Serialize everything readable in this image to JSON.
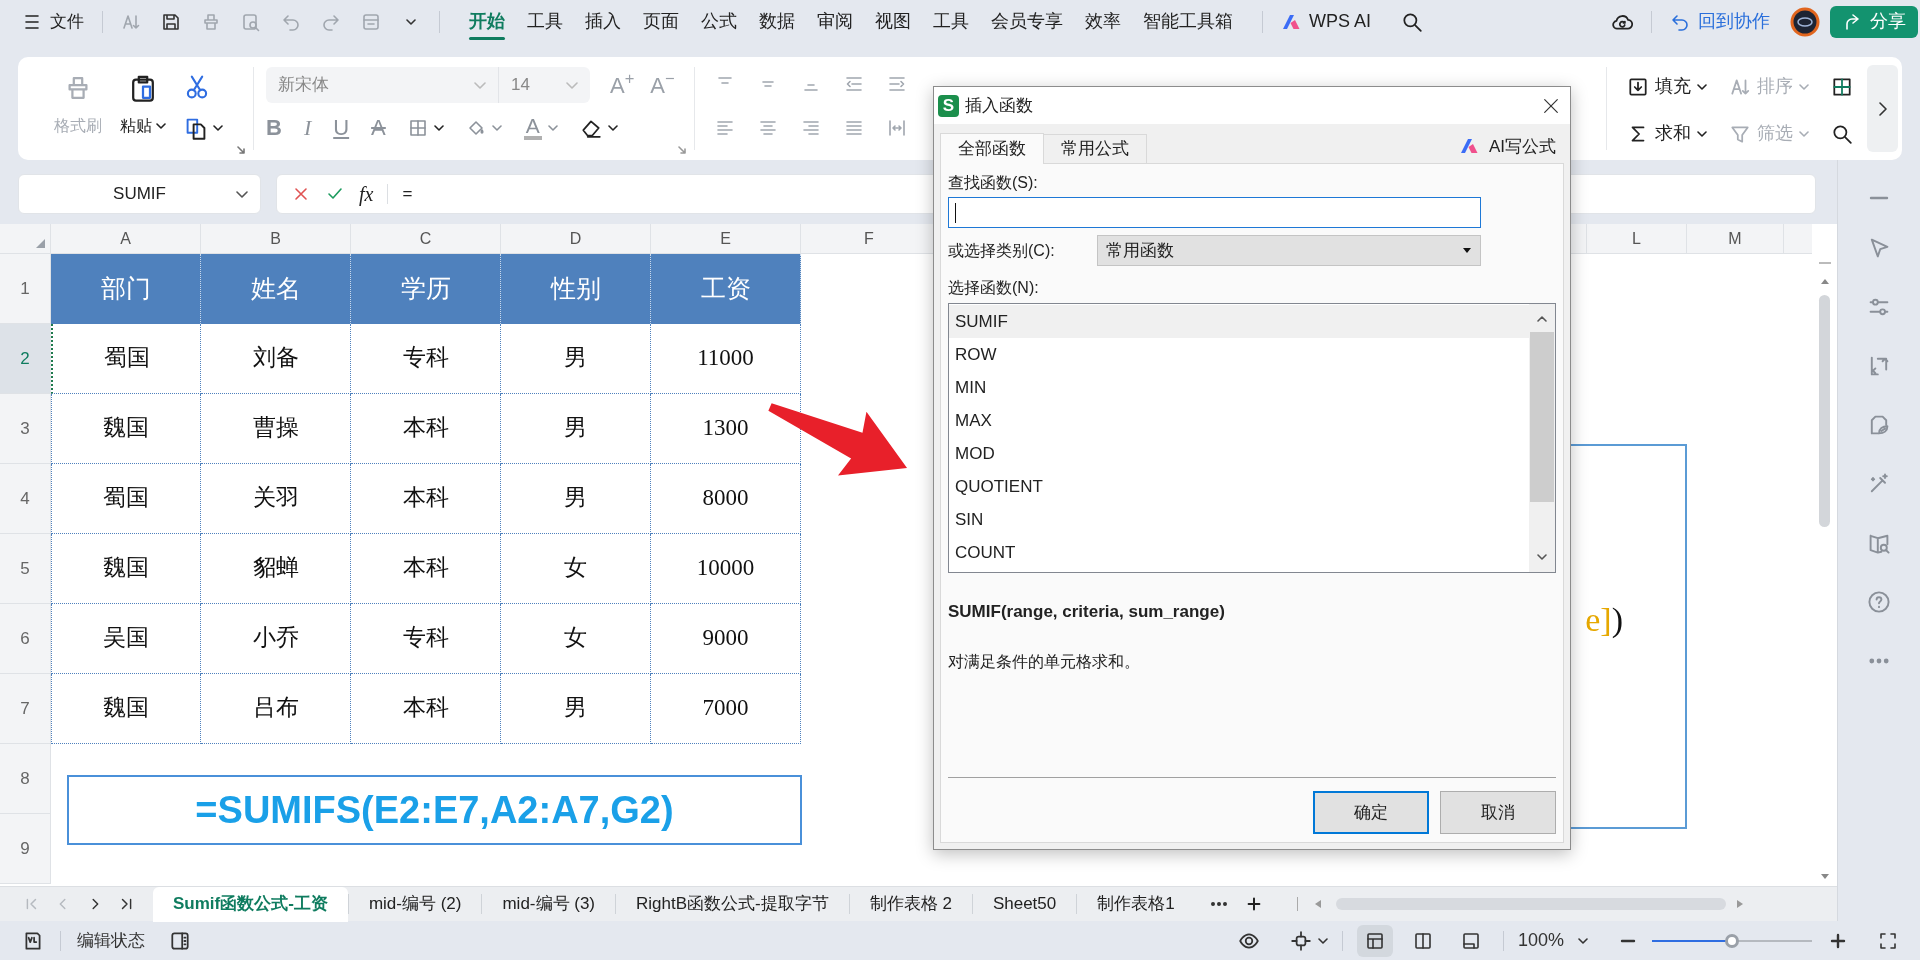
{
  "menu_bar": {
    "file": "文件",
    "tabs": [
      {
        "label": "开始",
        "selected": true
      },
      {
        "label": "工具",
        "selected": false
      },
      {
        "label": "插入",
        "selected": false
      },
      {
        "label": "页面",
        "selected": false
      },
      {
        "label": "公式",
        "selected": false
      },
      {
        "label": "数据",
        "selected": false
      },
      {
        "label": "审阅",
        "selected": false
      },
      {
        "label": "视图",
        "selected": false
      },
      {
        "label": "工具",
        "selected": false
      },
      {
        "label": "会员专享",
        "selected": false
      },
      {
        "label": "效率",
        "selected": false
      },
      {
        "label": "智能工具箱",
        "selected": false
      }
    ],
    "ai": "WPS AI",
    "collab": "回到协作",
    "share": "分享"
  },
  "ribbon": {
    "format_painter": {
      "label": "格式刷",
      "disabled": true
    },
    "paste": {
      "label": "粘贴",
      "disabled": false
    },
    "font_name": "新宋体",
    "font_size": "14",
    "grow_font": "A$^{+}$",
    "shrink_font": "A$^{−}$",
    "font_buttons": [
      {
        "kind": "bold",
        "label": "B"
      },
      {
        "kind": "italic",
        "label": "I"
      },
      {
        "kind": "underline",
        "label": "U"
      },
      {
        "kind": "strike",
        "label": "A"
      }
    ],
    "font_color": "A",
    "tools": [
      {
        "kind": "fill",
        "label": "填充",
        "disabled": false
      },
      {
        "kind": "sum",
        "label": "求和",
        "disabled": false
      },
      {
        "kind": "sort",
        "label": "排序",
        "disabled": true
      },
      {
        "kind": "filter",
        "label": "筛选",
        "disabled": true
      }
    ]
  },
  "formula_bar": {
    "name_box": "SUMIF",
    "fx": "fx",
    "formula": "="
  },
  "sheet": {
    "columns": [
      "A",
      "B",
      "C",
      "D",
      "E",
      "F",
      "L",
      "M"
    ],
    "rows": [
      {
        "label": "1",
        "selected": false
      },
      {
        "label": "2",
        "selected": true
      },
      {
        "label": "3",
        "selected": false
      },
      {
        "label": "4",
        "selected": false
      },
      {
        "label": "5",
        "selected": false
      },
      {
        "label": "6",
        "selected": false
      },
      {
        "label": "7",
        "selected": false
      },
      {
        "label": "8",
        "selected": false
      },
      {
        "label": "9",
        "selected": false
      }
    ],
    "table": {
      "header": [
        "部门",
        "姓名",
        "学历",
        "性别",
        "工资"
      ],
      "rows": [
        [
          "蜀国",
          "刘备",
          "专科",
          "男",
          "11000"
        ],
        [
          "魏国",
          "曹操",
          "本科",
          "男",
          "1300"
        ],
        [
          "蜀国",
          "关羽",
          "本科",
          "男",
          "8000"
        ],
        [
          "魏国",
          "貂蝉",
          "本科",
          "女",
          "10000"
        ],
        [
          "吴国",
          "小乔",
          "专科",
          "女",
          "9000"
        ],
        [
          "魏国",
          "吕布",
          "本科",
          "男",
          "7000"
        ]
      ]
    },
    "formula_box": "=SUMIFS(E2:E7,A2:A7,G2)",
    "syntax_tail": {
      "argument": "e]",
      "close": ")"
    },
    "annotations": [
      {
        "kind": "arrow"
      }
    ]
  },
  "dialog": {
    "badge": "S",
    "title": "插入函数",
    "tabs": [
      {
        "label": "全部函数",
        "selected": true
      },
      {
        "label": "常用公式",
        "selected": false
      }
    ],
    "ai_button": "AI写公式",
    "search_label": "查找函数(S):",
    "category_label": "或选择类别(C):",
    "category_value": "常用函数",
    "list_label": "选择函数(N):",
    "functions": [
      {
        "name": "SUMIF",
        "selected": true
      },
      {
        "name": "ROW",
        "selected": false
      },
      {
        "name": "MIN",
        "selected": false
      },
      {
        "name": "MAX",
        "selected": false
      },
      {
        "name": "MOD",
        "selected": false
      },
      {
        "name": "QUOTIENT",
        "selected": false
      },
      {
        "name": "SIN",
        "selected": false
      },
      {
        "name": "COUNT",
        "selected": false
      }
    ],
    "signature": "SUMIF(range, criteria, sum_range)",
    "description": "对满足条件的单元格求和。",
    "buttons": [
      {
        "label": "确定",
        "kind": "default"
      },
      {
        "label": "取消",
        "kind": "normal"
      }
    ]
  },
  "sheet_tabs": [
    {
      "label": "Sumif函数公式-工资",
      "selected": true
    },
    {
      "label": "mid-编号 (2)",
      "selected": false
    },
    {
      "label": "mid-编号 (3)",
      "selected": false
    },
    {
      "label": "RightB函数公式-提取字节",
      "selected": false
    },
    {
      "label": "制作表格 2",
      "selected": false
    },
    {
      "label": "Sheet50",
      "selected": false
    },
    {
      "label": "制作表格1",
      "selected": false
    }
  ],
  "status_bar": {
    "mode": "编辑状态",
    "views": [
      {
        "kind": "normal",
        "selected": true
      },
      {
        "kind": "split",
        "selected": false
      },
      {
        "kind": "page",
        "selected": false
      }
    ],
    "zoom": "100%",
    "zoom_slider": {
      "level": 0.5
    }
  }
}
